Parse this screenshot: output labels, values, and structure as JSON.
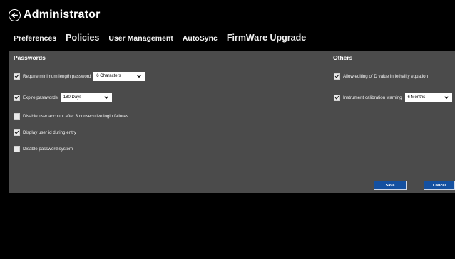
{
  "header": {
    "title": "Administrator",
    "back_icon": "back-arrow-circle-icon"
  },
  "tabs": [
    {
      "label": "Preferences"
    },
    {
      "label": "Policies"
    },
    {
      "label": "User Management"
    },
    {
      "label": "AutoSync"
    },
    {
      "label": "FirmWare Upgrade"
    }
  ],
  "passwords": {
    "title": "Passwords",
    "min_length": {
      "label": "Require minimum length password",
      "checked": true,
      "value": "6 Characters"
    },
    "expire": {
      "label": "Expire passwords",
      "checked": true,
      "value": "180 Days"
    },
    "disable_after_failures": {
      "label": "Disable user account after 3 consecutive login failures",
      "checked": false
    },
    "display_user_id": {
      "label": "Display user id during entry",
      "checked": true
    },
    "disable_password_system": {
      "label": "Disable password system",
      "checked": false
    }
  },
  "others": {
    "title": "Others",
    "allow_d_value": {
      "label": "Allow editing of D value in lethality equation",
      "checked": true
    },
    "calibration_warning": {
      "label": "Instrument calibration warning",
      "checked": true,
      "value": "6 Months"
    }
  },
  "actions": {
    "save_label": "Save",
    "cancel_label": "Cancel"
  },
  "colors": {
    "panel": "#4b4b4b",
    "background": "#000000",
    "button": "#1450a0"
  }
}
